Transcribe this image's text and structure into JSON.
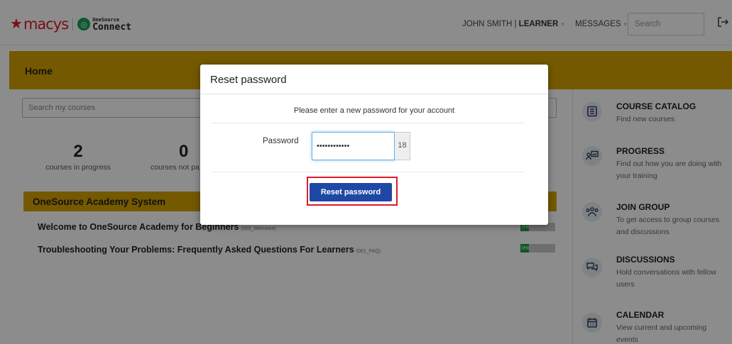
{
  "header": {
    "user_name": "JOHN SMITH",
    "user_sep": " | ",
    "user_role": "LEARNER",
    "messages": "MESSAGES",
    "search_placeholder": "Search",
    "logo_small": "OneSource",
    "logo_big": "Connect",
    "logo_macys": "macys"
  },
  "home": {
    "title": "Home",
    "search_placeholder": "Search my courses",
    "stats": [
      {
        "num": "2",
        "label": "courses in progress"
      },
      {
        "num": "0",
        "label": "courses not pa"
      }
    ],
    "section_title": "OneSource Academy System",
    "courses": [
      {
        "title": "Welcome to OneSource Academy for Beginners",
        "code": "(000_Welcome)",
        "progress": 0,
        "pct_label": "0%"
      },
      {
        "title": "Troubleshooting Your Problems: Frequently Asked Questions For Learners",
        "code": "(001_FAQ)",
        "progress": 0,
        "pct_label": "0%"
      }
    ]
  },
  "sidebar": {
    "items": [
      {
        "title": "COURSE CATALOG",
        "desc": "Find new courses",
        "icon": "catalog-icon"
      },
      {
        "title": "PROGRESS",
        "desc": "Find out how you are doing with your training",
        "icon": "progress-icon"
      },
      {
        "title": "JOIN GROUP",
        "desc": "To get access to group courses and discussions",
        "icon": "group-icon"
      },
      {
        "title": "DISCUSSIONS",
        "desc": "Hold conversations with fellow users",
        "icon": "discussions-icon"
      },
      {
        "title": "CALENDAR",
        "desc": "View current and upcoming events",
        "icon": "calendar-icon"
      }
    ]
  },
  "modal": {
    "title": "Reset password",
    "message": "Please enter a new password for your account",
    "password_label": "Password",
    "password_value": "••••••••••••",
    "char_count": "18",
    "button_label": "Reset password"
  },
  "colors": {
    "accent_yellow": "#d3a200",
    "button_blue": "#1f47a5",
    "highlight_red": "#e11a2b",
    "progress_green": "#1f9c4a"
  }
}
